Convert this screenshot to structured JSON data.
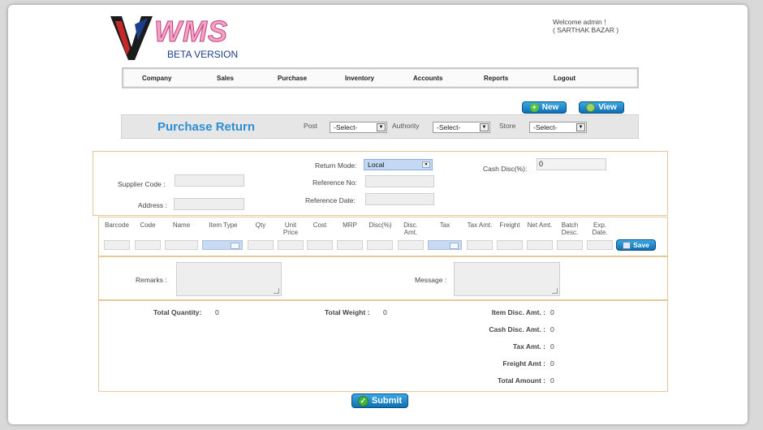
{
  "logo": {
    "brand": "WMS",
    "subtitle": "BETA VERSION"
  },
  "welcome": {
    "line1": "Welcome admin !",
    "line2": "( SARTHAK BAZAR )"
  },
  "nav": [
    "Company",
    "Sales",
    "Purchase",
    "Inventory",
    "Accounts",
    "Reports",
    "Logout"
  ],
  "buttons": {
    "new": "New",
    "view": "View",
    "save": "Save",
    "submit": "Submit"
  },
  "header": {
    "title": "Purchase Return",
    "post_label": "Post",
    "post_value": "-Select-",
    "authority_label": "Authority",
    "authority_value": "-Select-",
    "store_label": "Store",
    "store_value": "-Select-"
  },
  "form": {
    "supplier_code_label": "Supplier Code :",
    "address_label": "Address :",
    "return_mode_label": "Return Mode:",
    "return_mode_value": "Local",
    "reference_no_label": "Reference No:",
    "reference_date_label": "Reference Date:",
    "cash_disc_label": "Cash Disc(%):",
    "cash_disc_value": "0"
  },
  "item_columns": [
    "Barcode",
    "Code",
    "Name",
    "Item Type",
    "Qty",
    "Unit Price",
    "Cost",
    "MRP",
    "Disc(%)",
    "Disc. Amt.",
    "Tax",
    "Tax Amt.",
    "Freight",
    "Net Amt.",
    "Batch Desc.",
    "Exp. Date."
  ],
  "remarks": {
    "remarks_label": "Remarks :",
    "message_label": "Message :"
  },
  "totals": {
    "total_quantity_label": "Total Quantity:",
    "total_quantity": "0",
    "total_weight_label": "Total Weight :",
    "total_weight": "0",
    "item_disc_label": "Item Disc. Amt. :",
    "item_disc": "0",
    "cash_disc_label": "Cash Disc. Amt. :",
    "cash_disc": "0",
    "tax_label": "Tax Amt. :",
    "tax": "0",
    "freight_label": "Freight Amt :",
    "freight": "0",
    "total_amount_label": "Total Amount :",
    "total_amount": "0"
  },
  "colors": {
    "accent": "#2e8fd3",
    "button": "#1a7fc4",
    "panel_border": "#e6c99a",
    "logo_pink": "#f2a6c6",
    "logo_navy": "#1b3f8b"
  }
}
